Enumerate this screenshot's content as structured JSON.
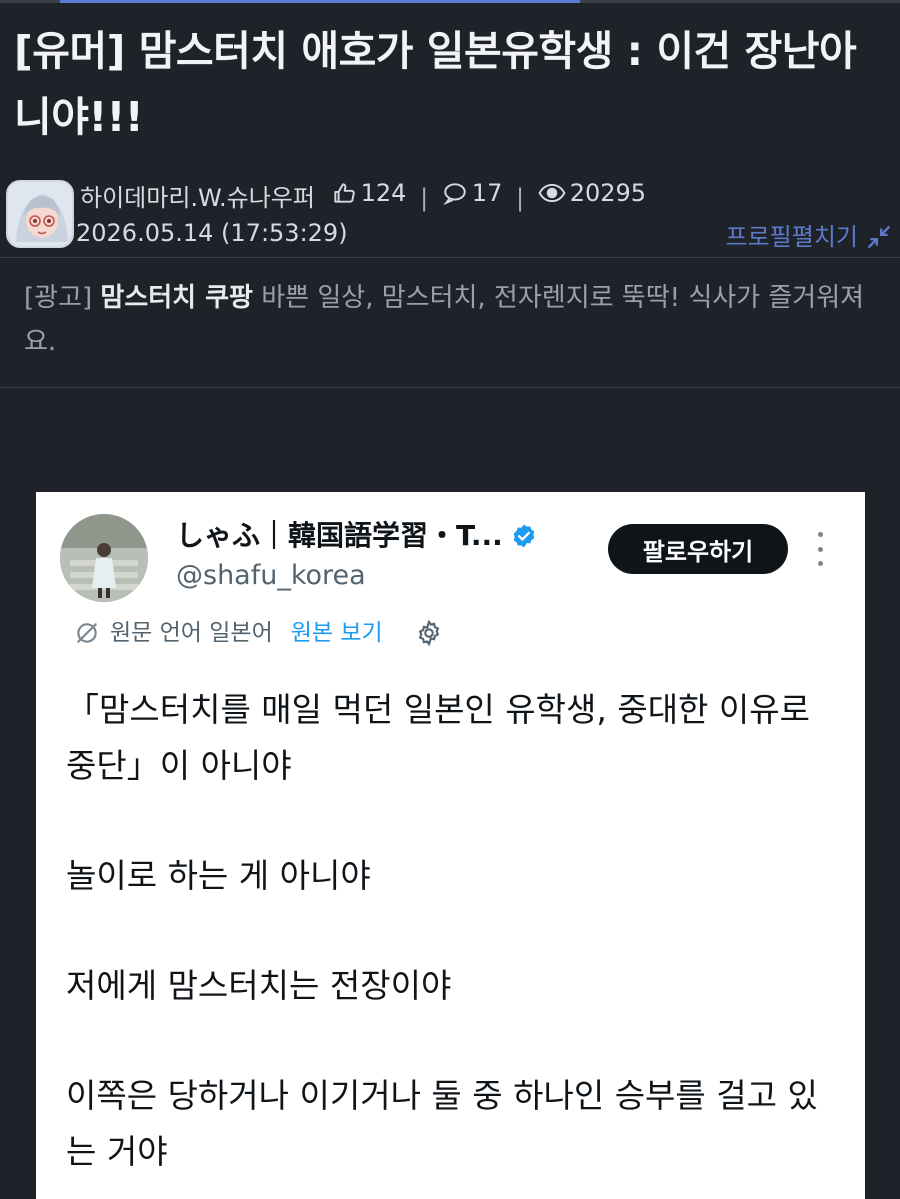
{
  "post": {
    "title": "[유머] 맘스터치 애호가 일본유학생 : 이건 장난아니야!!!",
    "author": "하이데마리.W.슈나우퍼",
    "likes": "124",
    "comments": "17",
    "views": "20295",
    "datetime": "2026.05.14 (17:53:29)",
    "profile_toggle": "프로필펼치기"
  },
  "ad": {
    "label": "[광고]",
    "brand": "맘스터치 쿠팡",
    "text": "바쁜 일상, 맘스터치, 전자렌지로 뚝딱! 식사가 즐거워져요."
  },
  "tweet": {
    "name": "しゃふ｜韓国語学習・T...",
    "handle": "@shafu_korea",
    "follow_label": "팔로우하기",
    "original_language": "원문 언어 일본어",
    "view_original": "원본 보기",
    "paragraphs": [
      "「맘스터치를 매일 먹던 일본인 유학생, 중대한 이유로 중단」이 아니야",
      "놀이로 하는 게 아니야",
      "저에게 맘스터치는 전장이야",
      "이쪽은 당하거나 이기거나 둘 중 하나인 승부를 걸고 있는 거야"
    ]
  },
  "colors": {
    "page_bg": "#1f2229",
    "accent_link": "#5d79c9",
    "verified": "#1d9bf0",
    "follow_bg": "#0f1419"
  },
  "icons": [
    "thumbs-up-icon",
    "comment-icon",
    "eye-icon",
    "collapse-arrows-icon",
    "verified-badge-icon",
    "more-vert-icon",
    "translate-icon",
    "settings-gear-icon"
  ]
}
